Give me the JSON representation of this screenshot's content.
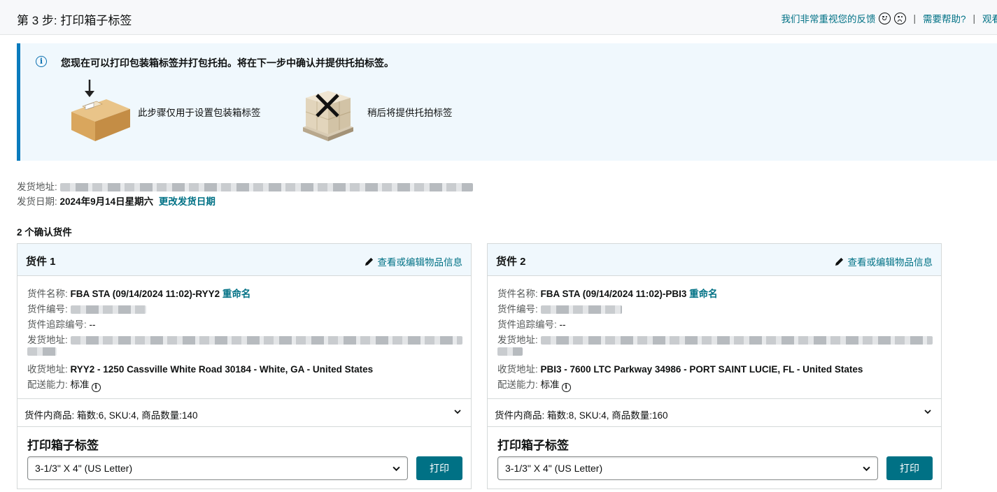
{
  "header": {
    "step_title": "第 3 步:  打印箱子标签",
    "feedback": "我们非常重视您的反馈",
    "help": "需要帮助?",
    "watch": "观看"
  },
  "info": {
    "message": "您现在可以打印包装箱标签并打包托拍。将在下一步中确认并提供托拍标签。",
    "box_label": "此步骤仅用于设置包装箱标签",
    "pallet_label": "稍后将提供托拍标签"
  },
  "ship": {
    "from_label": "发货地址:",
    "date_label": "发货日期:",
    "date_value": "2024年9月14日星期六",
    "change_date": "更改发货日期"
  },
  "confirmed_count": "2 个确认货件",
  "shipments": [
    {
      "title": "货件 1",
      "edit_link": "查看或编辑物品信息",
      "name_label": "货件名称:",
      "name_value": "FBA STA (09/14/2024 11:02)-RYY2",
      "rename": "重命名",
      "id_label": "货件编号:",
      "tracking_label": "货件追踪编号:",
      "tracking_value": "--",
      "from_label": "发货地址:",
      "to_label": "收货地址:",
      "to_value": "RYY2 - 1250 Cassville White Road 30184 - White, GA - United States",
      "capability_label": "配送能力:",
      "capability_value": "标准",
      "contents": "货件内商品: 箱数:6, SKU:4, 商品数量:140",
      "print_title": "打印箱子标签",
      "select_value": "3-1/3\" X 4\" (US Letter)",
      "print_button": "打印"
    },
    {
      "title": "货件 2",
      "edit_link": "查看或编辑物品信息",
      "name_label": "货件名称:",
      "name_value": "FBA STA (09/14/2024 11:02)-PBI3",
      "rename": "重命名",
      "id_label": "货件编号:",
      "tracking_label": "货件追踪编号:",
      "tracking_value": "--",
      "from_label": "发货地址:",
      "to_label": "收货地址:",
      "to_value": "PBI3 - 7600 LTC Parkway 34986 - PORT SAINT LUCIE, FL - United States",
      "capability_label": "配送能力:",
      "capability_value": "标准",
      "contents": "货件内商品: 箱数:8, SKU:4, 商品数量:160",
      "print_title": "打印箱子标签",
      "select_value": "3-1/3\" X 4\" (US Letter)",
      "print_button": "打印"
    }
  ],
  "colors": {
    "link": "#007185",
    "banner_bg": "#f0f8fd",
    "banner_accent": "#0a7bbd",
    "button": "#007185"
  },
  "icons": [
    "smile-icon",
    "frown-icon",
    "info-icon",
    "box-icon",
    "pallet-icon",
    "pencil-icon",
    "chevron-down-icon"
  ]
}
